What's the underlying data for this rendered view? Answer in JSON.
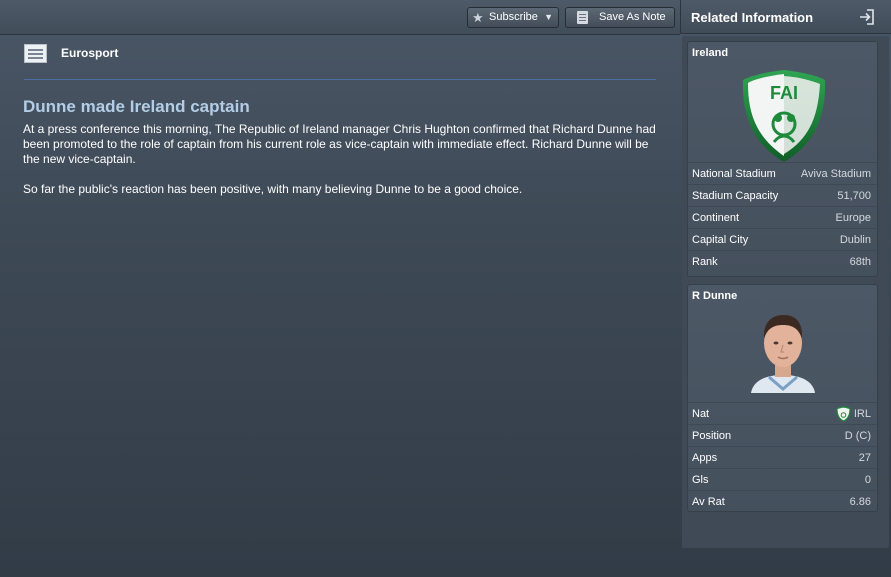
{
  "toolbar": {
    "subscribe_label": "Subscribe",
    "subscribe_icon": "star-icon",
    "save_note_label": "Save As Note",
    "save_note_icon": "note-icon"
  },
  "article": {
    "source": "Eurosport",
    "headline": "Dunne made Ireland captain",
    "paragraphs": [
      "At a press conference this morning, The Republic of Ireland manager Chris Hughton confirmed that Richard Dunne had been promoted to the role of captain from his current role as vice-captain with immediate effect. Richard Dunne will be the new vice-captain.",
      "So far the public's reaction has been positive, with many believing Dunne to be a good choice."
    ]
  },
  "related": {
    "title": "Related Information",
    "ireland": {
      "title": "Ireland",
      "logo_text": "FAI",
      "rows": [
        {
          "label": "National Stadium",
          "value": "Aviva Stadium"
        },
        {
          "label": "Stadium Capacity",
          "value": "51,700"
        },
        {
          "label": "Continent",
          "value": "Europe"
        },
        {
          "label": "Capital City",
          "value": "Dublin"
        },
        {
          "label": "Rank",
          "value": "68th"
        }
      ]
    },
    "player": {
      "title": "R Dunne",
      "rows": [
        {
          "label": "Nat",
          "value": "IRL"
        },
        {
          "label": "Position",
          "value": "D (C)"
        },
        {
          "label": "Apps",
          "value": "27"
        },
        {
          "label": "Gls",
          "value": "0"
        },
        {
          "label": "Av Rat",
          "value": "6.86"
        }
      ]
    }
  },
  "colors": {
    "headline": "#b3cde6",
    "divider": "#4b6fa3",
    "fai_green": "#1e8a3c"
  }
}
